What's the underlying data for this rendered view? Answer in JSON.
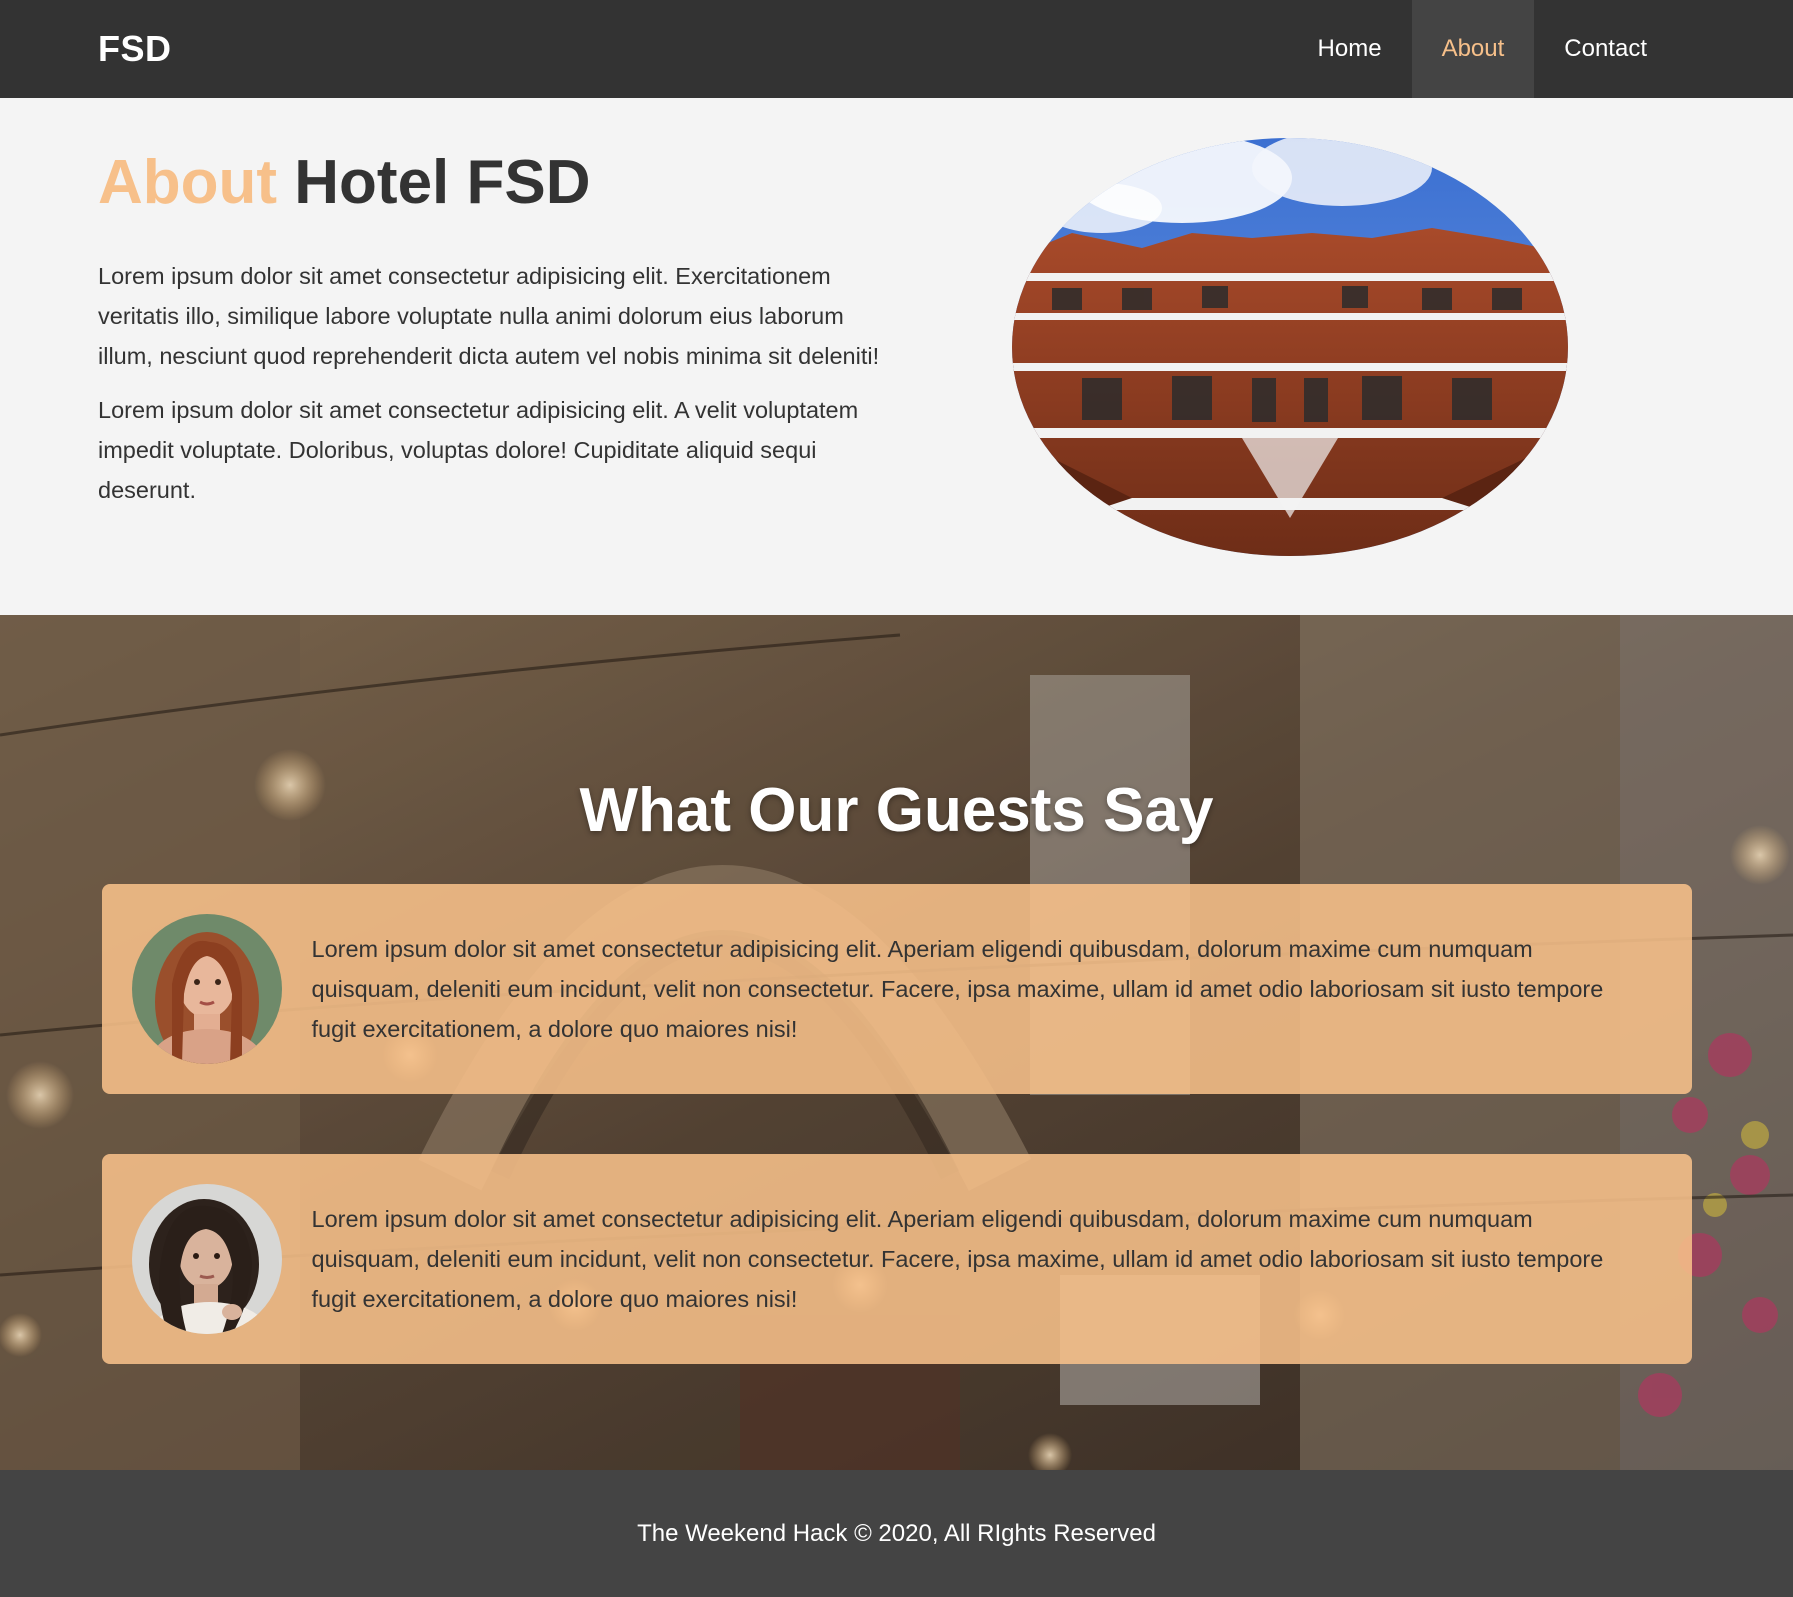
{
  "brand": {
    "logo": "FSD"
  },
  "nav": {
    "items": [
      {
        "label": "Home"
      },
      {
        "label": "About"
      },
      {
        "label": "Contact"
      }
    ],
    "active": "About"
  },
  "about": {
    "title_accent": "About",
    "title_rest": "Hotel FSD",
    "paragraphs": [
      "Lorem ipsum dolor sit amet consectetur adipisicing elit. Exercitationem veritatis illo, similique labore voluptate nulla animi dolorum eius laborum illum, nesciunt quod reprehenderit dicta autem vel nobis minima sit deleniti!",
      "Lorem ipsum dolor sit amet consectetur adipisicing elit. A velit voluptatem impedit voluptate. Doloribus, voluptas dolore! Cupiditate aliquid sequi deserunt."
    ]
  },
  "testimonials": {
    "title": "What Our Guests Say",
    "items": [
      {
        "text": "Lorem ipsum dolor sit amet consectetur adipisicing elit. Aperiam eligendi quibusdam, dolorum maxime cum numquam quisquam, deleniti eum incidunt, velit non consectetur. Facere, ipsa maxime, ullam id amet odio laboriosam sit iusto tempore fugit exercitationem, a dolore quo maiores nisi!"
      },
      {
        "text": "Lorem ipsum dolor sit amet consectetur adipisicing elit. Aperiam eligendi quibusdam, dolorum maxime cum numquam quisquam, deleniti eum incidunt, velit non consectetur. Facere, ipsa maxime, ullam id amet odio laboriosam sit iusto tempore fugit exercitationem, a dolore quo maiores nisi!"
      }
    ]
  },
  "footer": {
    "text": "The Weekend Hack © 2020, All RIghts Reserved"
  },
  "colors": {
    "accent": "#f7c08a",
    "navbar": "#333333",
    "footer": "#444444",
    "background": "#f4f4f4"
  }
}
